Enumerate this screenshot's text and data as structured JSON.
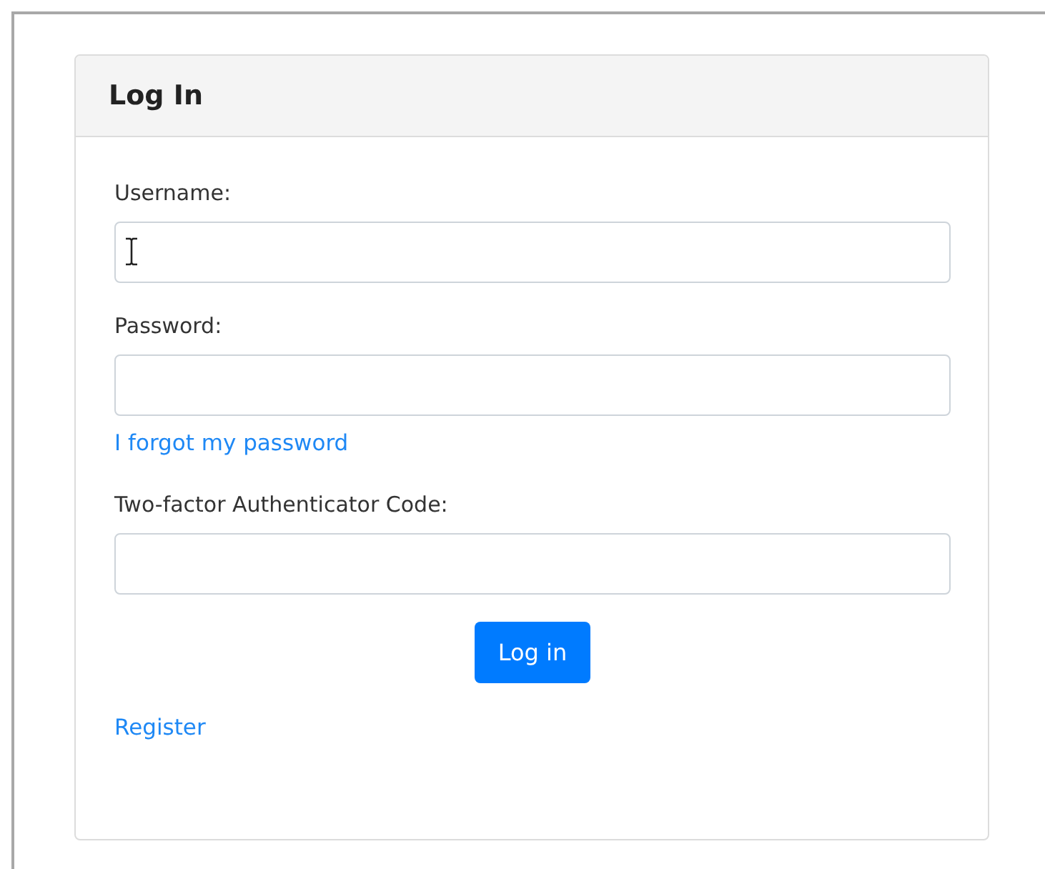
{
  "card": {
    "title": "Log In"
  },
  "fields": [
    {
      "label": "Username:"
    },
    {
      "label": "Password:",
      "link": "I forgot my password"
    },
    {
      "label": "Two-factor Authenticator Code:"
    }
  ],
  "submit_button": "Log in",
  "register_link": "Register"
}
